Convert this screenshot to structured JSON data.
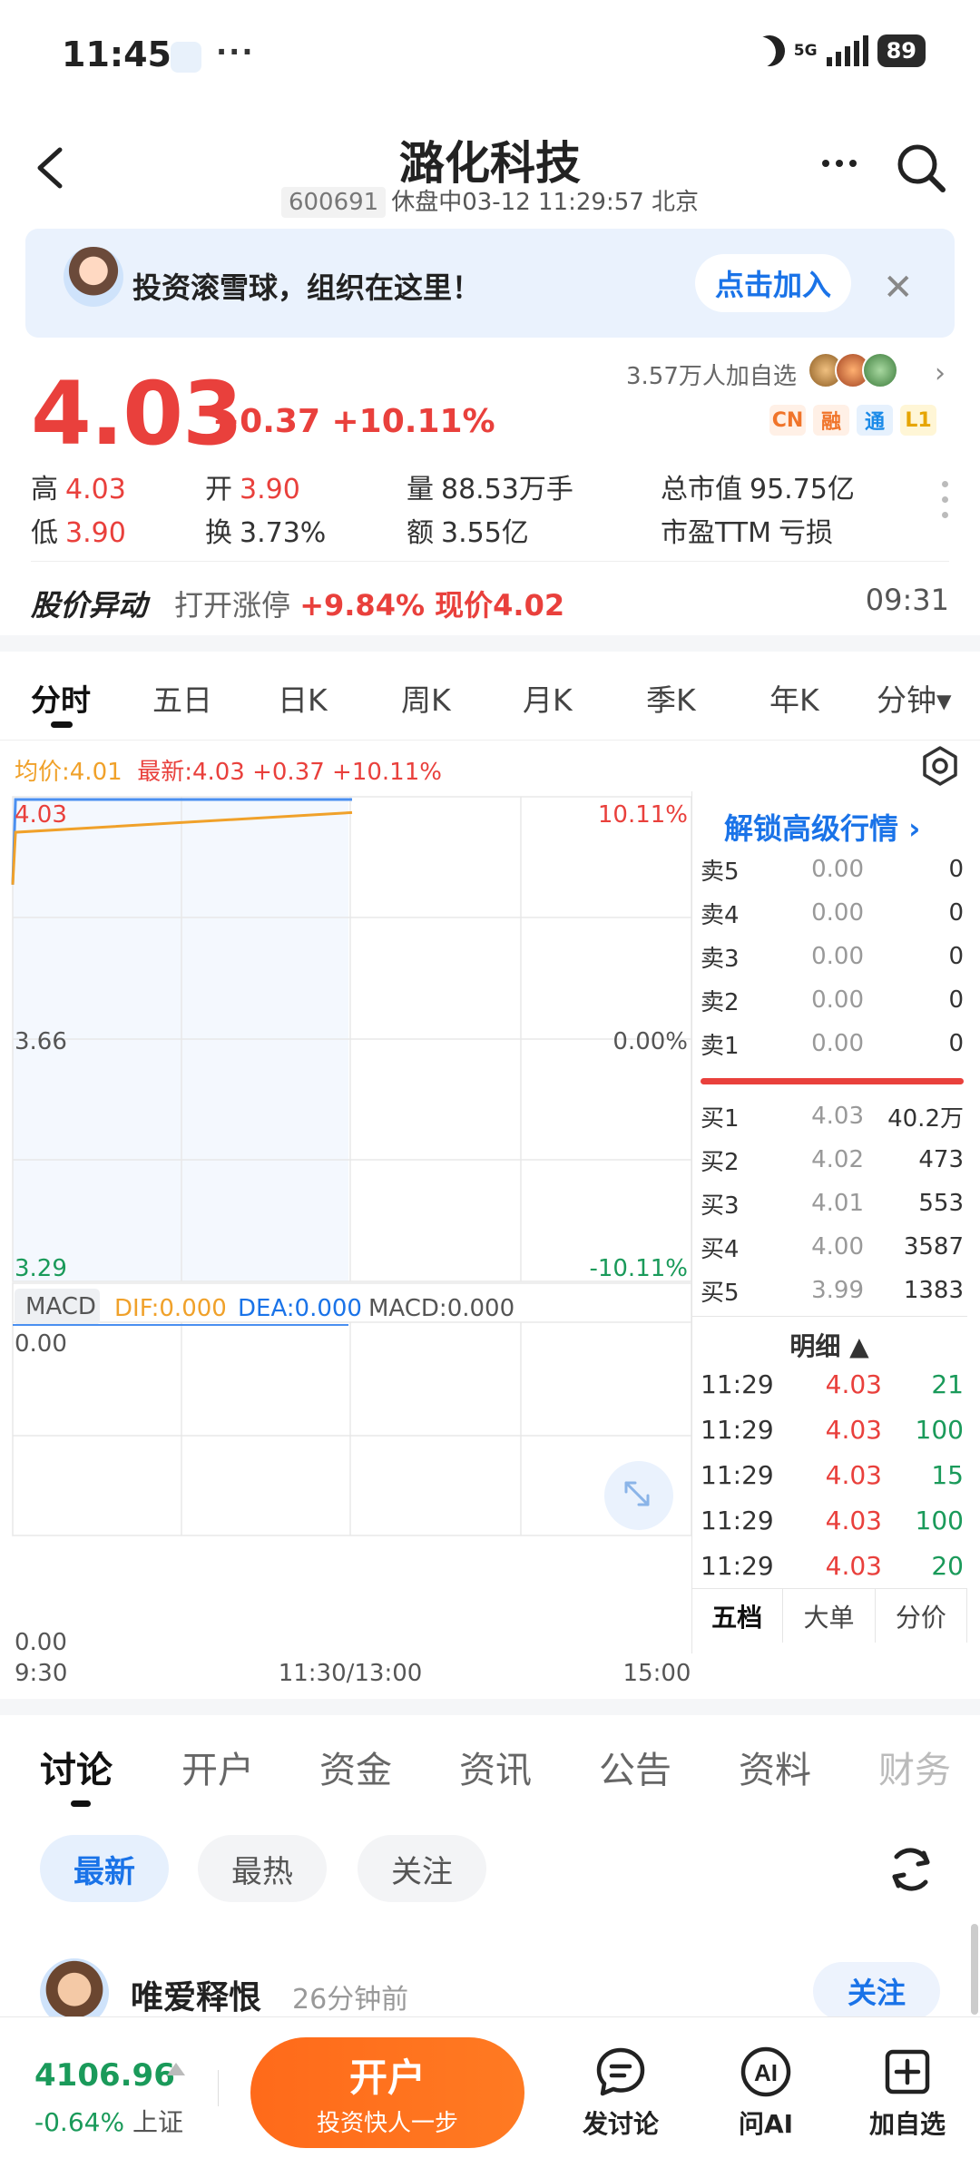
{
  "status_bar": {
    "time": "11:45",
    "dots": "···",
    "network": "5G",
    "battery": "89"
  },
  "header": {
    "title": "潞化科技",
    "code": "600691",
    "status": "休盘中03-12 11:29:57 北京"
  },
  "banner": {
    "text": "投资滚雪球，组织在这里！",
    "button": "点击加入"
  },
  "quote": {
    "price": "4.03",
    "change": "+0.37 +10.11%",
    "followers": "3.57万人加自选",
    "tags": [
      "CN",
      "融",
      "通",
      "L1"
    ],
    "stats": [
      {
        "label": "高",
        "value": "4.03",
        "color": "red"
      },
      {
        "label": "开",
        "value": "3.90",
        "color": "red"
      },
      {
        "label": "量",
        "value": "88.53万手",
        "color": "dark"
      },
      {
        "label": "总市值",
        "value": "95.75亿",
        "color": "dark"
      },
      {
        "label": "低",
        "value": "3.90",
        "color": "red"
      },
      {
        "label": "换",
        "value": "3.73%",
        "color": "dark"
      },
      {
        "label": "额",
        "value": "3.55亿",
        "color": "dark"
      },
      {
        "label": "市盈TTM",
        "value": "亏损",
        "color": "dark"
      }
    ]
  },
  "abnormal": {
    "title": "股价异动",
    "label": "打开涨停",
    "value": "+9.84% 现价4.02",
    "time": "09:31"
  },
  "chart_tabs": [
    "分时",
    "五日",
    "日K",
    "周K",
    "月K",
    "季K",
    "年K",
    "分钟▾"
  ],
  "chart_info": {
    "avg": "均价:4.01",
    "last": "最新:4.03 +0.37 +10.11%"
  },
  "chart_data": {
    "type": "line",
    "title": "",
    "ylim": [
      3.29,
      4.03
    ],
    "y_ticks_left": [
      "4.03",
      "3.66",
      "3.29"
    ],
    "y_ticks_right": [
      "10.11%",
      "0.00%",
      "-10.11%"
    ],
    "x_ticks": [
      "9:30",
      "11:30/13:00",
      "15:00"
    ],
    "series": [
      {
        "name": "最新",
        "color": "#4a8ff0",
        "x": [
          "9:30",
          "9:31",
          "11:30"
        ],
        "values": [
          3.9,
          4.03,
          4.03
        ]
      },
      {
        "name": "均价",
        "color": "#f0a12a",
        "x": [
          "9:30",
          "9:31",
          "11:30"
        ],
        "values": [
          3.9,
          3.98,
          4.01
        ]
      }
    ],
    "macd": {
      "label": "MACD",
      "dif": "DIF:0.000",
      "dea": "DEA:0.000",
      "macd": "MACD:0.000",
      "top": "0.00",
      "bottom": "0.00"
    }
  },
  "order_book": {
    "unlock": "解锁高级行情 ›",
    "asks": [
      {
        "label": "卖5",
        "price": "0.00",
        "qty": "0"
      },
      {
        "label": "卖4",
        "price": "0.00",
        "qty": "0"
      },
      {
        "label": "卖3",
        "price": "0.00",
        "qty": "0"
      },
      {
        "label": "卖2",
        "price": "0.00",
        "qty": "0"
      },
      {
        "label": "卖1",
        "price": "0.00",
        "qty": "0"
      }
    ],
    "bids": [
      {
        "label": "买1",
        "price": "4.03",
        "qty": "40.2万"
      },
      {
        "label": "买2",
        "price": "4.02",
        "qty": "473"
      },
      {
        "label": "买3",
        "price": "4.01",
        "qty": "553"
      },
      {
        "label": "买4",
        "price": "4.00",
        "qty": "3587"
      },
      {
        "label": "买5",
        "price": "3.99",
        "qty": "1383"
      }
    ],
    "detail_title": "明细 ▲",
    "trades": [
      {
        "time": "11:29",
        "price": "4.03",
        "qty": "21"
      },
      {
        "time": "11:29",
        "price": "4.03",
        "qty": "100"
      },
      {
        "time": "11:29",
        "price": "4.03",
        "qty": "15"
      },
      {
        "time": "11:29",
        "price": "4.03",
        "qty": "100"
      },
      {
        "time": "11:29",
        "price": "4.03",
        "qty": "20"
      }
    ],
    "footer": [
      "五档",
      "大单",
      "分价"
    ]
  },
  "discussion": {
    "tabs": [
      "讨论",
      "开户",
      "资金",
      "资讯",
      "公告",
      "资料",
      "财务"
    ],
    "filters": [
      "最新",
      "最热",
      "关注"
    ],
    "post": {
      "user": "唯爱释恨",
      "time": "26分钟前",
      "follow": "关注"
    }
  },
  "bottom_bar": {
    "index_value": "4106.96",
    "index_change": "-0.64%",
    "index_name": "上证",
    "open_title": "开户",
    "open_sub": "投资快人一步",
    "items": [
      "发讨论",
      "问AI",
      "加自选"
    ]
  }
}
